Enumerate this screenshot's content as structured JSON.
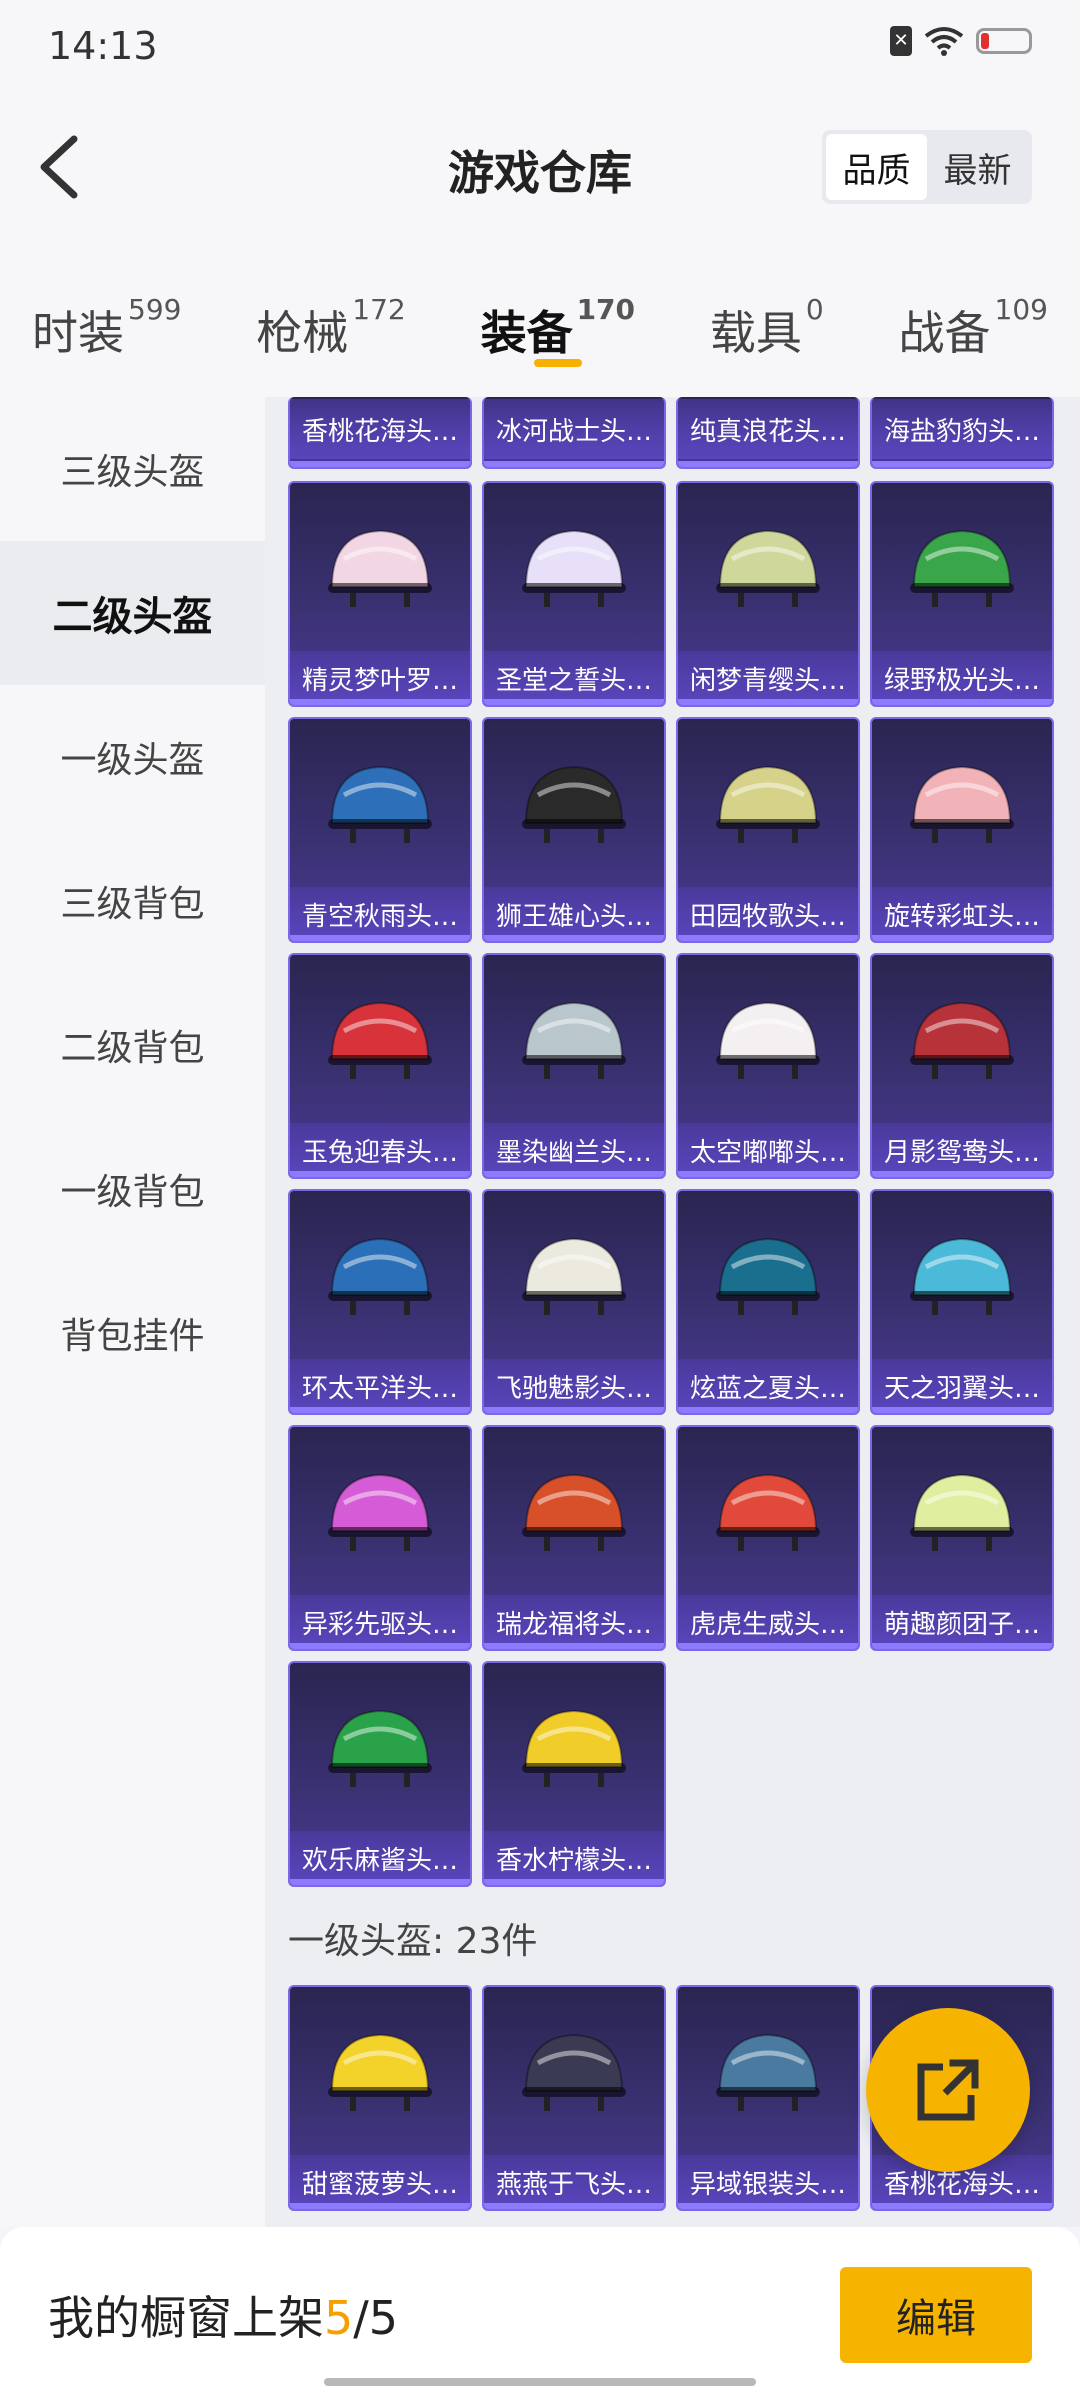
{
  "status": {
    "time": "14:13"
  },
  "header": {
    "title": "游戏仓库",
    "sort_options": [
      "品质",
      "最新"
    ]
  },
  "categories": [
    {
      "label": "时装",
      "count": "599"
    },
    {
      "label": "枪械",
      "count": "172"
    },
    {
      "label": "装备",
      "count": "170"
    },
    {
      "label": "载具",
      "count": "0"
    },
    {
      "label": "战备",
      "count": "109"
    }
  ],
  "sidebar": [
    "三级头盔",
    "二级头盔",
    "一级头盔",
    "三级背包",
    "二级背包",
    "一级背包",
    "背包挂件"
  ],
  "top_partial": [
    "香桃花海头…",
    "冰河战士头…",
    "纯真浪花头…",
    "海盐豹豹头…"
  ],
  "level2_items": [
    {
      "name": "精灵梦叶罗…",
      "color": "#f3d6e4"
    },
    {
      "name": "圣堂之誓头…",
      "color": "#e8e0f8"
    },
    {
      "name": "闲梦青缨头…",
      "color": "#cfd79a"
    },
    {
      "name": "绿野极光头…",
      "color": "#3aa64a"
    },
    {
      "name": "青空秋雨头…",
      "color": "#2d6fb8"
    },
    {
      "name": "狮王雄心头…",
      "color": "#2b2a2a"
    },
    {
      "name": "田园牧歌头…",
      "color": "#d6d28a"
    },
    {
      "name": "旋转彩虹头…",
      "color": "#f2b3b8"
    },
    {
      "name": "玉兔迎春头…",
      "color": "#d8323a"
    },
    {
      "name": "墨染幽兰头…",
      "color": "#b9c6cc"
    },
    {
      "name": "太空嘟嘟头…",
      "color": "#f4f0f2"
    },
    {
      "name": "月影鸳鸯头…",
      "color": "#b8323a"
    },
    {
      "name": "环太平洋头…",
      "color": "#2b6fb8"
    },
    {
      "name": "飞驰魅影头…",
      "color": "#eceadf"
    },
    {
      "name": "炫蓝之夏头…",
      "color": "#1a6f8e"
    },
    {
      "name": "天之羽翼头…",
      "color": "#4bb9d8"
    },
    {
      "name": "异彩先驱头…",
      "color": "#d65bd6"
    },
    {
      "name": "瑞龙福将头…",
      "color": "#d8502a"
    },
    {
      "name": "虎虎生威头…",
      "color": "#e14a3a"
    },
    {
      "name": "萌趣颜团子…",
      "color": "#e0eea0"
    },
    {
      "name": "欢乐麻酱头…",
      "color": "#2aa24a"
    },
    {
      "name": "香水柠檬头…",
      "color": "#f1cd2a"
    }
  ],
  "section_level1": "一级头盔: 23件",
  "level1_items": [
    {
      "name": "甜蜜菠萝头…",
      "color": "#f3d22a"
    },
    {
      "name": "燕燕于飞头…",
      "color": "#3a3a52"
    },
    {
      "name": "异域银装头…",
      "color": "#4a7aa0"
    },
    {
      "name": "香桃花海头…",
      "color": "#e86aa0"
    }
  ],
  "bottom": {
    "label": "我的橱窗上架",
    "current": "5",
    "sep_total": "/5",
    "edit": "编辑"
  }
}
